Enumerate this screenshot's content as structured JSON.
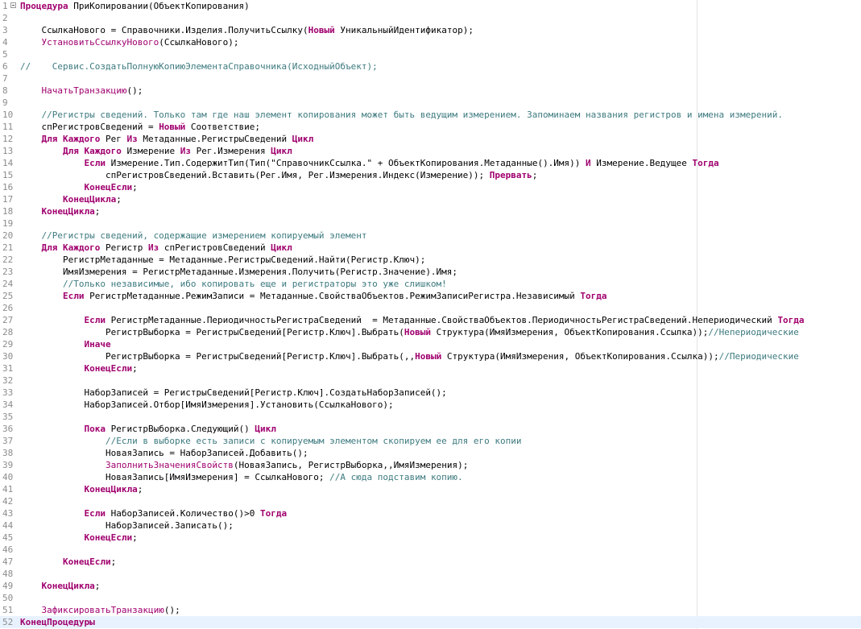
{
  "editor": {
    "lines": [
      {
        "num": "1",
        "tokens": [
          {
            "t": "Процедура",
            "c": "kw"
          },
          {
            "t": " ПриКопировании(ОбъектКопирования)",
            "c": "pl"
          }
        ]
      },
      {
        "num": "2",
        "tokens": []
      },
      {
        "num": "3",
        "tokens": [
          {
            "t": "    СсылкаНового = Справочники.Изделия.ПолучитьСсылку(",
            "c": "pl"
          },
          {
            "t": "Новый",
            "c": "kw"
          },
          {
            "t": " УникальныйИдентификатор);",
            "c": "pl"
          }
        ]
      },
      {
        "num": "4",
        "tokens": [
          {
            "t": "    ",
            "c": "pl"
          },
          {
            "t": "УстановитьСсылкуНового",
            "c": "pr"
          },
          {
            "t": "(СсылкаНового);",
            "c": "pl"
          }
        ]
      },
      {
        "num": "5",
        "tokens": []
      },
      {
        "num": "6",
        "tokens": [
          {
            "t": "//    Сервис.СоздатьПолнуюКопиюЭлементаСправочника(ИсходныйОбъект);",
            "c": "cm"
          }
        ]
      },
      {
        "num": "7",
        "tokens": []
      },
      {
        "num": "8",
        "tokens": [
          {
            "t": "    ",
            "c": "pl"
          },
          {
            "t": "НачатьТранзакцию",
            "c": "pr"
          },
          {
            "t": "();",
            "c": "pl"
          }
        ]
      },
      {
        "num": "9",
        "tokens": []
      },
      {
        "num": "10",
        "tokens": [
          {
            "t": "    //Регистры сведений. Только там где наш элемент копирования может быть ведущим измерением. Запоминаем названия регистров и имена измерений.",
            "c": "cm"
          }
        ]
      },
      {
        "num": "11",
        "tokens": [
          {
            "t": "    спРегистровСведений = ",
            "c": "pl"
          },
          {
            "t": "Новый",
            "c": "kw"
          },
          {
            "t": " Соответствие;",
            "c": "pl"
          }
        ]
      },
      {
        "num": "12",
        "tokens": [
          {
            "t": "    ",
            "c": "pl"
          },
          {
            "t": "Для Каждого",
            "c": "kw"
          },
          {
            "t": " Рег ",
            "c": "pl"
          },
          {
            "t": "Из",
            "c": "kw"
          },
          {
            "t": " Метаданные.РегистрыСведений ",
            "c": "pl"
          },
          {
            "t": "Цикл",
            "c": "kw"
          }
        ]
      },
      {
        "num": "13",
        "tokens": [
          {
            "t": "        ",
            "c": "pl"
          },
          {
            "t": "Для Каждого",
            "c": "kw"
          },
          {
            "t": " Измерение ",
            "c": "pl"
          },
          {
            "t": "Из",
            "c": "kw"
          },
          {
            "t": " Рег.Измерения ",
            "c": "pl"
          },
          {
            "t": "Цикл",
            "c": "kw"
          }
        ]
      },
      {
        "num": "14",
        "tokens": [
          {
            "t": "            ",
            "c": "pl"
          },
          {
            "t": "Если",
            "c": "kw"
          },
          {
            "t": " Измерение.Тип.СодержитТип(Тип(",
            "c": "pl"
          },
          {
            "t": "\"СправочникСсылка.\"",
            "c": "st"
          },
          {
            "t": " + ОбъектКопирования.Метаданные().Имя)) ",
            "c": "pl"
          },
          {
            "t": "И",
            "c": "kw"
          },
          {
            "t": " Измерение.Ведущее ",
            "c": "pl"
          },
          {
            "t": "Тогда",
            "c": "kw"
          }
        ]
      },
      {
        "num": "15",
        "tokens": [
          {
            "t": "                спРегистровСведений.Вставить(Рег.Имя, Рег.Измерения.Индекс(Измерение)); ",
            "c": "pl"
          },
          {
            "t": "Прервать",
            "c": "kw"
          },
          {
            "t": ";",
            "c": "pl"
          }
        ]
      },
      {
        "num": "16",
        "tokens": [
          {
            "t": "            ",
            "c": "pl"
          },
          {
            "t": "КонецЕсли",
            "c": "kw"
          },
          {
            "t": ";",
            "c": "pl"
          }
        ]
      },
      {
        "num": "17",
        "tokens": [
          {
            "t": "        ",
            "c": "pl"
          },
          {
            "t": "КонецЦикла",
            "c": "kw"
          },
          {
            "t": ";",
            "c": "pl"
          }
        ]
      },
      {
        "num": "18",
        "tokens": [
          {
            "t": "    ",
            "c": "pl"
          },
          {
            "t": "КонецЦикла",
            "c": "kw"
          },
          {
            "t": ";",
            "c": "pl"
          }
        ]
      },
      {
        "num": "19",
        "tokens": []
      },
      {
        "num": "20",
        "tokens": [
          {
            "t": "    //Регистры сведений, содержащие измерением копируемый элемент",
            "c": "cm"
          }
        ]
      },
      {
        "num": "21",
        "tokens": [
          {
            "t": "    ",
            "c": "pl"
          },
          {
            "t": "Для Каждого",
            "c": "kw"
          },
          {
            "t": " Регистр ",
            "c": "pl"
          },
          {
            "t": "Из",
            "c": "kw"
          },
          {
            "t": " спРегистровСведений ",
            "c": "pl"
          },
          {
            "t": "Цикл",
            "c": "kw"
          }
        ]
      },
      {
        "num": "22",
        "tokens": [
          {
            "t": "        РегистрМетаданные = Метаданные.РегистрыСведений.Найти(Регистр.Ключ);",
            "c": "pl"
          }
        ]
      },
      {
        "num": "23",
        "tokens": [
          {
            "t": "        ИмяИзмерения = РегистрМетаданные.Измерения.Получить(Регистр.Значение).Имя;",
            "c": "pl"
          }
        ]
      },
      {
        "num": "24",
        "tokens": [
          {
            "t": "        //Только независимые, ибо копировать еще и регистраторы это уже слишком!",
            "c": "cm"
          }
        ]
      },
      {
        "num": "25",
        "tokens": [
          {
            "t": "        ",
            "c": "pl"
          },
          {
            "t": "Если",
            "c": "kw"
          },
          {
            "t": " РегистрМетаданные.РежимЗаписи = Метаданные.СвойстваОбъектов.РежимЗаписиРегистра.Независимый ",
            "c": "pl"
          },
          {
            "t": "Тогда",
            "c": "kw"
          }
        ]
      },
      {
        "num": "26",
        "tokens": []
      },
      {
        "num": "27",
        "tokens": [
          {
            "t": "            ",
            "c": "pl"
          },
          {
            "t": "Если",
            "c": "kw"
          },
          {
            "t": " РегистрМетаданные.ПериодичностьРегистраСведений  = Метаданные.СвойстваОбъектов.ПериодичностьРегистраСведений.Непериодический ",
            "c": "pl"
          },
          {
            "t": "Тогда",
            "c": "kw"
          }
        ]
      },
      {
        "num": "28",
        "tokens": [
          {
            "t": "                РегистрВыборка = РегистрыСведений[Регистр.Ключ].Выбрать(",
            "c": "pl"
          },
          {
            "t": "Новый",
            "c": "kw"
          },
          {
            "t": " Структура(ИмяИзмерения, ОбъектКопирования.Ссылка));",
            "c": "pl"
          },
          {
            "t": "//Непериодические",
            "c": "cm"
          }
        ]
      },
      {
        "num": "29",
        "tokens": [
          {
            "t": "            ",
            "c": "pl"
          },
          {
            "t": "Иначе",
            "c": "kw"
          }
        ]
      },
      {
        "num": "30",
        "tokens": [
          {
            "t": "                РегистрВыборка = РегистрыСведений[Регистр.Ключ].Выбрать(,,",
            "c": "pl"
          },
          {
            "t": "Новый",
            "c": "kw"
          },
          {
            "t": " Структура(ИмяИзмерения, ОбъектКопирования.Ссылка));",
            "c": "pl"
          },
          {
            "t": "//Периодические",
            "c": "cm"
          }
        ]
      },
      {
        "num": "31",
        "tokens": [
          {
            "t": "            ",
            "c": "pl"
          },
          {
            "t": "КонецЕсли",
            "c": "kw"
          },
          {
            "t": ";",
            "c": "pl"
          }
        ]
      },
      {
        "num": "32",
        "tokens": []
      },
      {
        "num": "33",
        "tokens": [
          {
            "t": "            НаборЗаписей = РегистрыСведений[Регистр.Ключ].СоздатьНаборЗаписей();",
            "c": "pl"
          }
        ]
      },
      {
        "num": "34",
        "tokens": [
          {
            "t": "            НаборЗаписей.Отбор[ИмяИзмерения].Установить(СсылкаНового);",
            "c": "pl"
          }
        ]
      },
      {
        "num": "35",
        "tokens": []
      },
      {
        "num": "36",
        "tokens": [
          {
            "t": "            ",
            "c": "pl"
          },
          {
            "t": "Пока",
            "c": "kw"
          },
          {
            "t": " РегистрВыборка.Следующий() ",
            "c": "pl"
          },
          {
            "t": "Цикл",
            "c": "kw"
          }
        ]
      },
      {
        "num": "37",
        "tokens": [
          {
            "t": "                //Если в выборке есть записи с копируемым элементом скопируем ее для его копии",
            "c": "cm"
          }
        ]
      },
      {
        "num": "38",
        "tokens": [
          {
            "t": "                НоваяЗапись = НаборЗаписей.Добавить();",
            "c": "pl"
          }
        ]
      },
      {
        "num": "39",
        "tokens": [
          {
            "t": "                ",
            "c": "pl"
          },
          {
            "t": "ЗаполнитьЗначенияСвойств",
            "c": "pr"
          },
          {
            "t": "(НоваяЗапись, РегистрВыборка,,ИмяИзмерения);",
            "c": "pl"
          }
        ]
      },
      {
        "num": "40",
        "tokens": [
          {
            "t": "                НоваяЗапись[ИмяИзмерения] = СсылкаНового; ",
            "c": "pl"
          },
          {
            "t": "//А сюда подставим копию.",
            "c": "cm"
          }
        ]
      },
      {
        "num": "41",
        "tokens": [
          {
            "t": "            ",
            "c": "pl"
          },
          {
            "t": "КонецЦикла",
            "c": "kw"
          },
          {
            "t": ";",
            "c": "pl"
          }
        ]
      },
      {
        "num": "42",
        "tokens": []
      },
      {
        "num": "43",
        "tokens": [
          {
            "t": "            ",
            "c": "pl"
          },
          {
            "t": "Если",
            "c": "kw"
          },
          {
            "t": " НаборЗаписей.Количество()>0 ",
            "c": "pl"
          },
          {
            "t": "Тогда",
            "c": "kw"
          }
        ]
      },
      {
        "num": "44",
        "tokens": [
          {
            "t": "                НаборЗаписей.Записать();",
            "c": "pl"
          }
        ]
      },
      {
        "num": "45",
        "tokens": [
          {
            "t": "            ",
            "c": "pl"
          },
          {
            "t": "КонецЕсли",
            "c": "kw"
          },
          {
            "t": ";",
            "c": "pl"
          }
        ]
      },
      {
        "num": "46",
        "tokens": []
      },
      {
        "num": "47",
        "tokens": [
          {
            "t": "        ",
            "c": "pl"
          },
          {
            "t": "КонецЕсли",
            "c": "kw"
          },
          {
            "t": ";",
            "c": "pl"
          }
        ]
      },
      {
        "num": "48",
        "tokens": []
      },
      {
        "num": "49",
        "tokens": [
          {
            "t": "    ",
            "c": "pl"
          },
          {
            "t": "КонецЦикла",
            "c": "kw"
          },
          {
            "t": ";",
            "c": "pl"
          }
        ]
      },
      {
        "num": "50",
        "tokens": []
      },
      {
        "num": "51",
        "tokens": [
          {
            "t": "    ",
            "c": "pl"
          },
          {
            "t": "ЗафиксироватьТранзакцию",
            "c": "pr"
          },
          {
            "t": "();",
            "c": "pl"
          }
        ]
      },
      {
        "num": "52",
        "tokens": [
          {
            "t": "КонецПроцедуры",
            "c": "kw"
          }
        ]
      }
    ],
    "current_line": "52"
  }
}
